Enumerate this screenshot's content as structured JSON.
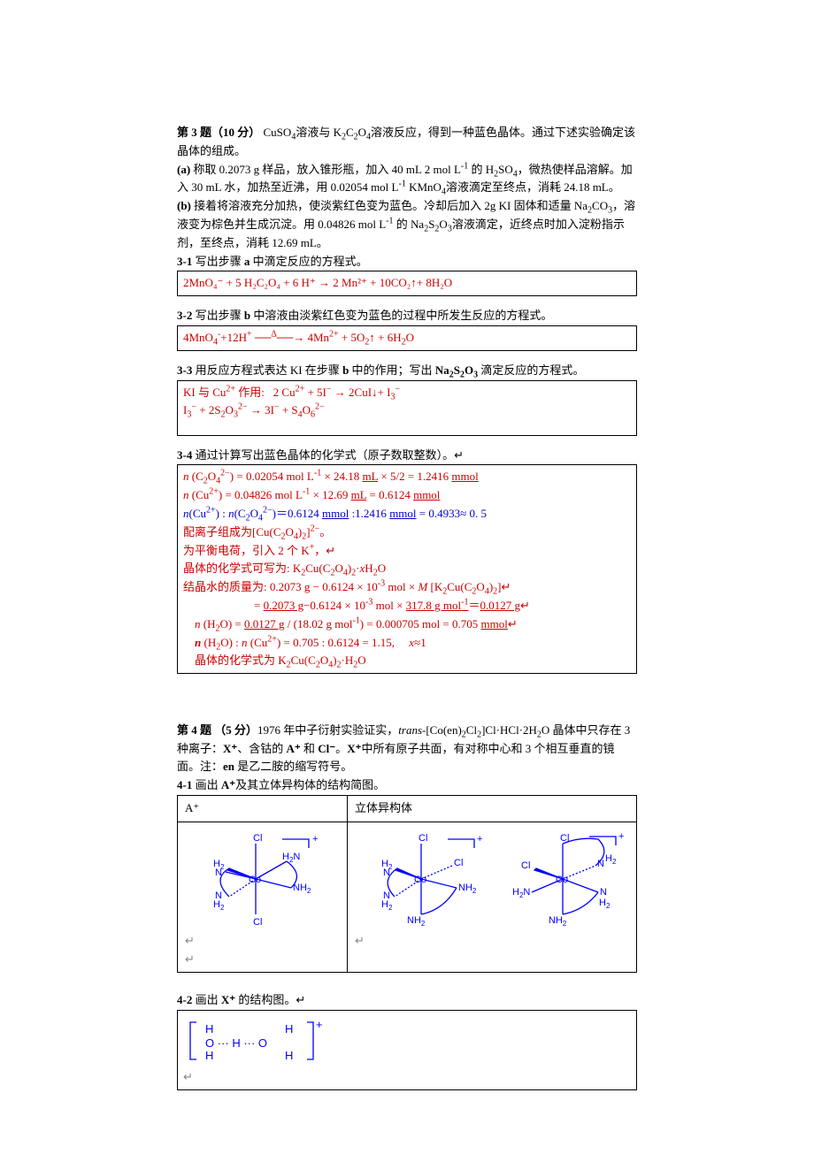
{
  "q3": {
    "title": "第 3 题（10 分）  CuSO₄溶液与 K₂C₂O₄溶液反应，得到一种蓝色晶体。通过下述实验确定该晶体的组成。",
    "a": "(a) 称取 0.2073 g 样品，放入锥形瓶，加入 40 mL 2 mol L⁻¹ 的 H₂SO₄，微热使样品溶解。加入 30 mL 水，加热至近沸，用 0.02054 mol L⁻¹ KMnO₄溶液滴定至终点，消耗 24.18 mL。",
    "b": "(b) 接着将溶液充分加热，使淡紫红色变为蓝色。冷却后加入 2g KI 固体和适量 Na₂CO₃，溶液变为棕色并生成沉淀。用 0.04826 mol L⁻¹ 的 Na₂S₂O₃溶液滴定，近终点时加入淀粉指示剂，至终点，消耗 12.69 mL。",
    "p31": "3-1 写出步骤 a 中滴定反应的方程式。",
    "a31": "2MnO₄⁻ + 5 H₂C₂O₄ + 6 H⁺ → 2 Mn²⁺ + 10CO₂↑+ 8H₂O",
    "p32": "3-2 写出步骤 b 中溶液由淡紫红色变为蓝色的过程中所发生反应的方程式。",
    "a32": "4MnO₄⁻+12H⁺ ──Δ──→ 4Mn²⁺ + 5O₂↑ + 6H₂O",
    "p33": "3-3 用反应方程式表达 KI 在步骤 b 中的作用；写出 Na₂S₂O₃ 滴定反应的方程式。",
    "a33a": "KI 与 Cu²⁺ 作用:   2 Cu²⁺ + 5I⁻ → 2CuI↓+ I₃⁻",
    "a33b": "I₃⁻ + 2S₂O₃²⁻ → 3I⁻ + S₄O₆²⁻",
    "p34": "3-4 通过计算写出蓝色晶体的化学式（原子数取整数）。↵",
    "a34": {
      "l1": "n (C₂O₄²⁻)  =  0.02054 mol L⁻¹ × 24.18 mL × 5/2  =  1.2416 mmol",
      "l2": "n (Cu²⁺) = 0.04826 mol L⁻¹ × 12.69 mL = 0.6124 mmol",
      "l3": "n(Cu²⁺) : n(C₂O₄²⁻)＝0.6124 mmol :1.2416 mmol  = 0.4933≈ 0. 5",
      "l4": "配离子组成为[Cu(C₂O₄)₂]²⁻。",
      "l5": "为平衡电荷，引入 2 个 K⁺，↵",
      "l6": "晶体的化学式可写为: K₂Cu(C₂O₄)₂·xH₂O",
      "l7": "结晶水的质量为:  0.2073 g  −  0.6124  ×  10⁻³ mol  ×  M [K₂Cu(C₂O₄)₂]↵",
      "l8": "=  0.2073 g−0.6124  ×  10⁻³ mol  ×  317.8 g mol⁻¹＝0.0127 g↵",
      "l9": "n (H₂O) = 0.0127 g / (18.02 g mol⁻¹) = 0.000705 mol = 0.705 mmol↵",
      "l10": "n (H₂O) : n (Cu²⁺)  =  0.705 : 0.6124 = 1.15,      x≈1",
      "l11": "晶体的化学式为 K₂Cu(C₂O₄)₂·H₂O"
    }
  },
  "q4": {
    "title": "第 4 题 （5 分）1976 年中子衍射实验证实，trans-[Co(en)₂Cl₂]Cl·HCl·2H₂O 晶体中只存在 3 种离子：X⁺、含钴的 A⁺ 和 Cl⁻。X⁺中所有原子共面，有对称中心和 3 个相互垂直的镜面。注：en 是乙二胺的缩写符号。",
    "p41": "4-1 画出 A⁺及其立体异构体的结构简图。",
    "hA": "A⁺",
    "hB": "立体异构体",
    "p42": "4-2 画出 X⁺ 的结构图。↵"
  }
}
